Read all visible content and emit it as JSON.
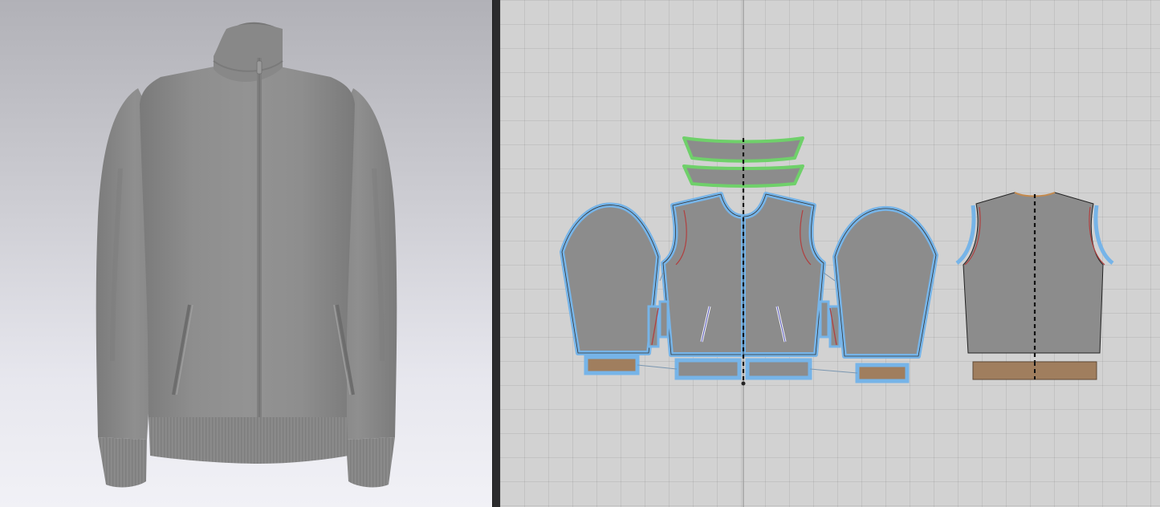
{
  "app": {
    "viewports": [
      {
        "id": "3d",
        "content": "avatar-garment-view"
      },
      {
        "id": "2d",
        "content": "pattern-window"
      }
    ]
  },
  "garment": {
    "type": "stand-collar zip track jacket",
    "fabric_color": "#8c8c8c",
    "rib_color": "#a07e5e",
    "seam_highlight_color": "#76b4e8",
    "collar_highlight_color": "#6fd06a",
    "background_top": "#b1b1b7",
    "background_bottom": "#f1f1f6"
  },
  "patterns": {
    "pieces": [
      "collar-outer",
      "collar-inner",
      "left-sleeve",
      "front-left",
      "front-right",
      "right-sleeve",
      "back",
      "left-cuff",
      "front-hem-left",
      "front-hem-right",
      "right-cuff",
      "back-hem",
      "pocket-welt-left",
      "pocket-welt-right"
    ],
    "selected": "all",
    "grid": true
  }
}
